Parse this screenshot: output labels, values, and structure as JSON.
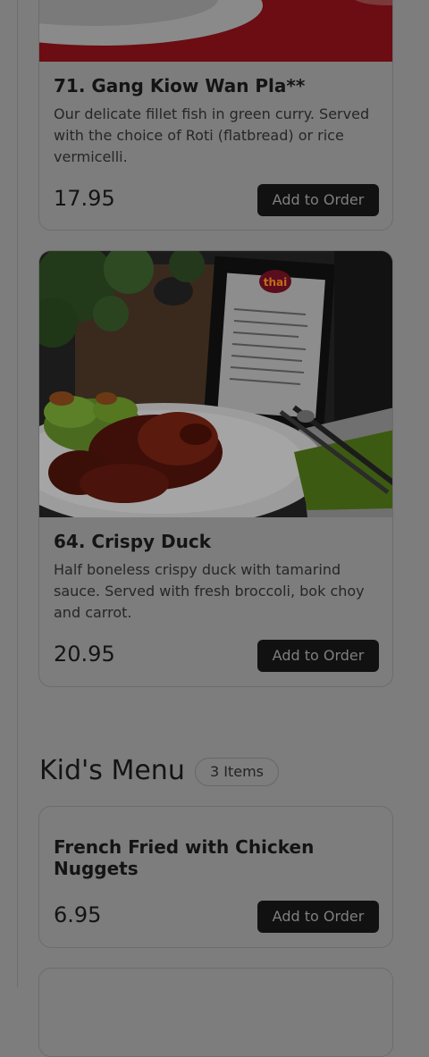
{
  "menu_items": [
    {
      "title": "71. Gang Kiow Wan Pla**",
      "description": "Our delicate fillet fish in green curry. Served with the choice of Roti (flatbread) or rice vermicelli.",
      "price": "17.95",
      "button": "Add to Order"
    },
    {
      "title": "64. Crispy Duck",
      "description": "Half boneless crispy duck with tamarind sauce. Served with fresh broccoli, bok choy and carrot.",
      "price": "20.95",
      "button": "Add to Order",
      "image_menu_logo": "thai"
    }
  ],
  "kids_section": {
    "title": "Kid's Menu",
    "count": "3 Items",
    "items": [
      {
        "title": "French Fried with Chicken Nuggets",
        "price": "6.95",
        "button": "Add to Order"
      }
    ]
  },
  "colors": {
    "overlay_background": "#7d7d7d",
    "button_bg": "#111111",
    "plate_red": "#6b0d12"
  }
}
